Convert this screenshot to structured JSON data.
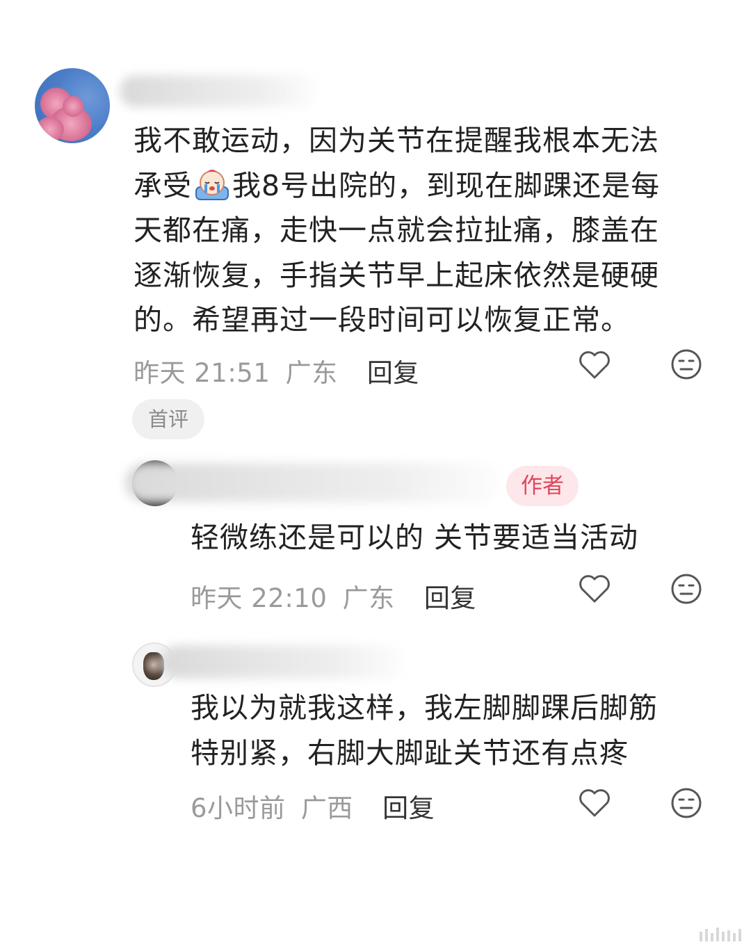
{
  "comments": [
    {
      "text_a": "我不敢运动，因为关节在提醒我根本无法\n承受",
      "emoji": "crying-face-emoji",
      "text_b": "我8号出院的，到现在脚踝还是每\n天都在痛，走快一点就会拉扯痛，膝盖在\n逐渐恢复，手指关节早上起床依然是硬硬\n的。希望再过一段时间可以恢复正常。",
      "time": "昨天 21:51",
      "location": "广东",
      "reply_label": "回复",
      "badge": "首评"
    },
    {
      "badge": "作者",
      "text": "轻微练还是可以的 关节要适当活动",
      "time": "昨天 22:10",
      "location": "广东",
      "reply_label": "回复"
    },
    {
      "text": "我以为就我这样，我左脚脚踝后脚筋\n特别紧，右脚大脚趾关节还有点疼",
      "time": "6小时前",
      "location": "广西",
      "reply_label": "回复"
    }
  ],
  "icons": {
    "like": "heart-outline-icon",
    "dislike": "neutral-face-icon"
  },
  "colors": {
    "text": "#222222",
    "meta": "#9a9a9a",
    "author_badge_text": "#e0455b",
    "author_badge_bg": "#fde7ea",
    "first_badge_bg": "#f0f0f0"
  }
}
